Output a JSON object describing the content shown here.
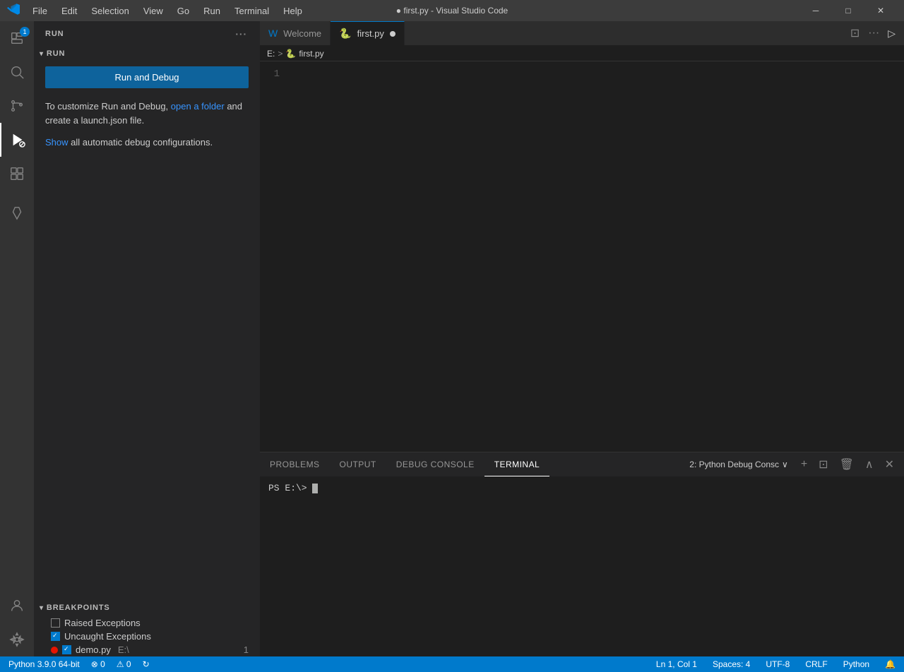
{
  "title_bar": {
    "title": "● first.py - Visual Studio Code",
    "menu_items": [
      "File",
      "Edit",
      "Selection",
      "View",
      "Go",
      "Run",
      "Terminal",
      "Help"
    ],
    "logo": "❐",
    "minimize": "─",
    "maximize": "□",
    "close": "✕"
  },
  "activity_bar": {
    "items": [
      {
        "id": "explorer",
        "icon": "📄",
        "badge": "1",
        "has_badge": true
      },
      {
        "id": "search",
        "icon": "🔍",
        "has_badge": false
      },
      {
        "id": "source-control",
        "icon": "⑂",
        "has_badge": false
      },
      {
        "id": "run",
        "icon": "▶",
        "has_badge": false,
        "active": true
      },
      {
        "id": "extensions",
        "icon": "⊞",
        "has_badge": false
      }
    ],
    "bottom_items": [
      {
        "id": "account",
        "icon": "👤"
      },
      {
        "id": "settings",
        "icon": "⚙"
      }
    ]
  },
  "sidebar": {
    "title": "RUN",
    "ellipsis": "···",
    "run_section": {
      "label": "RUN",
      "run_button": "Run and Debug",
      "customize_text_before": "To customize Run and Debug,",
      "customize_link1": "open a folder",
      "customize_text_mid": "and create a launch.json file.",
      "show_link": "Show",
      "show_text_after": "all automatic debug configurations."
    },
    "breakpoints": {
      "label": "BREAKPOINTS",
      "items": [
        {
          "id": "raised",
          "label": "Raised Exceptions",
          "checked": false
        },
        {
          "id": "uncaught",
          "label": "Uncaught Exceptions",
          "checked": true
        },
        {
          "id": "demo",
          "label": "demo.py",
          "path": "E:\\",
          "line": "1",
          "has_dot": true
        }
      ]
    }
  },
  "editor": {
    "tabs": [
      {
        "id": "welcome",
        "label": "Welcome",
        "icon": "🅦",
        "active": false,
        "modified": false
      },
      {
        "id": "first-py",
        "label": "first.py",
        "icon": "🐍",
        "active": true,
        "modified": true
      }
    ],
    "breadcrumb": {
      "drive": "E:",
      "sep1": ">",
      "file_icon": "🐍",
      "file": "first.py"
    },
    "lines": [
      ""
    ],
    "line_numbers": [
      "1"
    ]
  },
  "panel": {
    "tabs": [
      "PROBLEMS",
      "OUTPUT",
      "DEBUG CONSOLE",
      "TERMINAL"
    ],
    "active_tab": "TERMINAL",
    "terminal_label": "2: Python Debug Consc",
    "prompt": "PS  E:\\> ",
    "actions": [
      "+",
      "⊡",
      "🗑",
      "∧",
      "✕"
    ]
  },
  "status_bar": {
    "python_version": "Python 3.9.0 64-bit",
    "errors": "⊗ 0",
    "warnings": "⚠ 0",
    "sync": "↻",
    "position": "Ln 1, Col 1",
    "spaces": "Spaces: 4",
    "encoding": "UTF-8",
    "line_ending": "CRLF",
    "language": "Python",
    "notification": "🔔",
    "remote": "⤨"
  }
}
